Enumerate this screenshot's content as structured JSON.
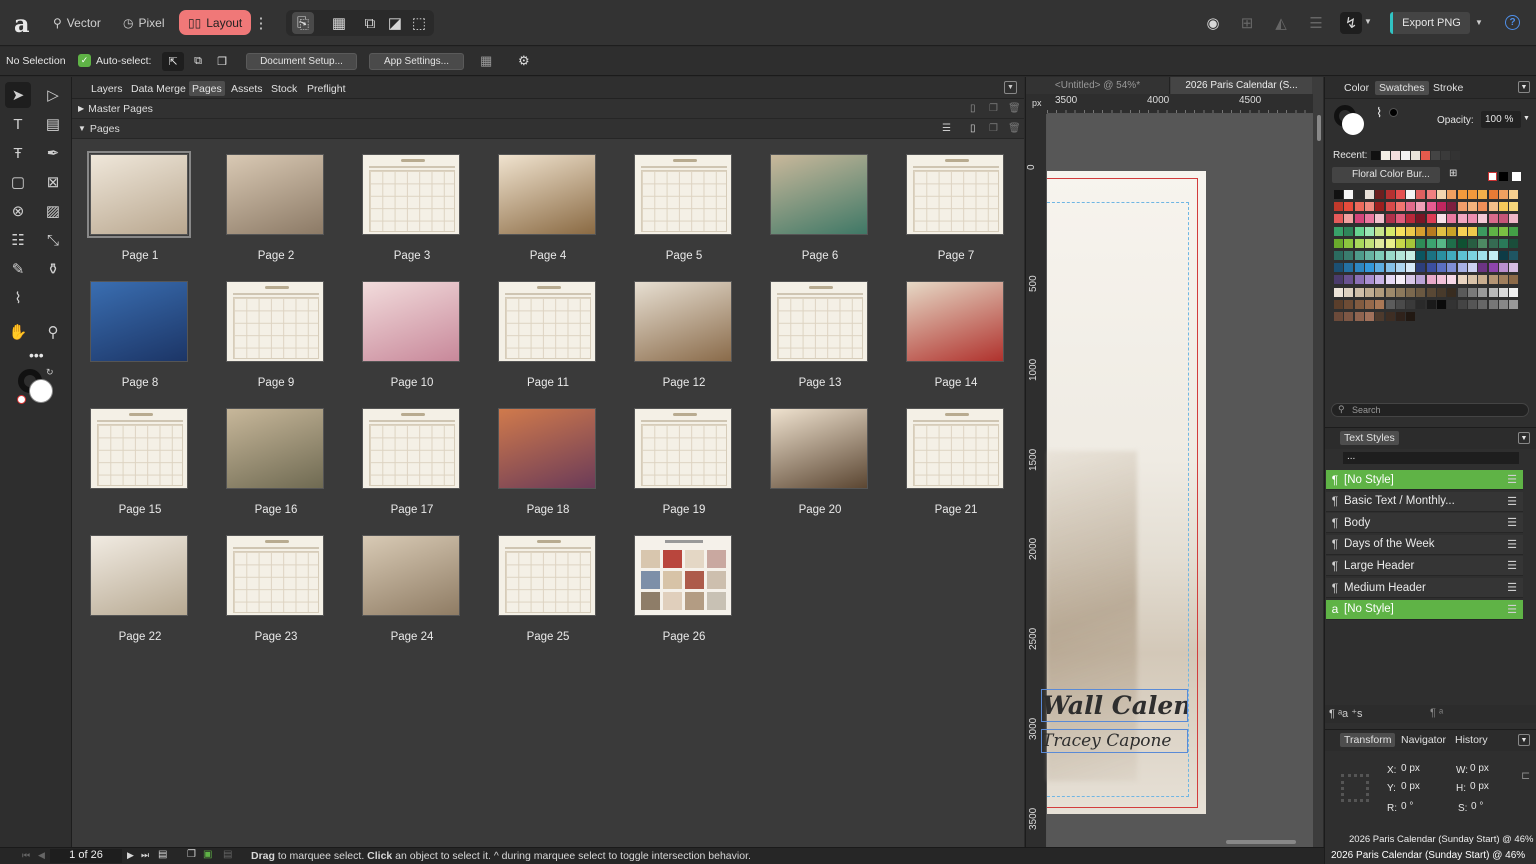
{
  "app": {
    "logo": "a"
  },
  "personas": [
    {
      "label": "Vector",
      "icon": "vector-persona-icon"
    },
    {
      "label": "Pixel",
      "icon": "pixel-persona-icon"
    },
    {
      "label": "Layout",
      "icon": "layout-persona-icon"
    }
  ],
  "topbar": {
    "export_label": "Export PNG",
    "help": "?"
  },
  "context": {
    "selection": "No Selection",
    "autoselect_label": "Auto-select:",
    "doc_setup": "Document Setup...",
    "app_settings": "App Settings..."
  },
  "panel_tabs": [
    "Layers",
    "Data Merge",
    "Pages",
    "Assets",
    "Stock",
    "Preflight"
  ],
  "sections": {
    "master": "Master Pages",
    "pages": "Pages"
  },
  "pages": [
    {
      "label": "Page 1",
      "kind": "photo",
      "c1": "#efe7da",
      "c2": "#b9a78f"
    },
    {
      "label": "Page 2",
      "kind": "photo",
      "c1": "#d9c9b4",
      "c2": "#8c7a66"
    },
    {
      "label": "Page 3",
      "kind": "cal"
    },
    {
      "label": "Page 4",
      "kind": "photo",
      "c1": "#f0e3cf",
      "c2": "#8a6a43"
    },
    {
      "label": "Page 5",
      "kind": "cal"
    },
    {
      "label": "Page 6",
      "kind": "photo",
      "c1": "#c9b89b",
      "c2": "#3f7866"
    },
    {
      "label": "Page 7",
      "kind": "cal"
    },
    {
      "label": "Page 8",
      "kind": "photo",
      "c1": "#3a6eb1",
      "c2": "#1c3566"
    },
    {
      "label": "Page 9",
      "kind": "cal"
    },
    {
      "label": "Page 10",
      "kind": "photo",
      "c1": "#f2dcdc",
      "c2": "#c8889a"
    },
    {
      "label": "Page 11",
      "kind": "cal"
    },
    {
      "label": "Page 12",
      "kind": "photo",
      "c1": "#e7dfd2",
      "c2": "#8a6b4a"
    },
    {
      "label": "Page 13",
      "kind": "cal"
    },
    {
      "label": "Page 14",
      "kind": "photo",
      "c1": "#e6d9c6",
      "c2": "#b0322d"
    },
    {
      "label": "Page 15",
      "kind": "cal"
    },
    {
      "label": "Page 16",
      "kind": "photo",
      "c1": "#c7b79a",
      "c2": "#6f6a52"
    },
    {
      "label": "Page 17",
      "kind": "cal"
    },
    {
      "label": "Page 18",
      "kind": "photo",
      "c1": "#d07a4c",
      "c2": "#6b3b58"
    },
    {
      "label": "Page 19",
      "kind": "cal"
    },
    {
      "label": "Page 20",
      "kind": "photo",
      "c1": "#efe2cf",
      "c2": "#5b4632"
    },
    {
      "label": "Page 21",
      "kind": "cal"
    },
    {
      "label": "Page 22",
      "kind": "photo",
      "c1": "#f1ebe2",
      "c2": "#b7a992"
    },
    {
      "label": "Page 23",
      "kind": "cal"
    },
    {
      "label": "Page 24",
      "kind": "photo",
      "c1": "#d8cab5",
      "c2": "#8f7c64"
    },
    {
      "label": "Page 25",
      "kind": "cal"
    },
    {
      "label": "Page 26",
      "kind": "collage"
    }
  ],
  "doc_tabs": [
    "<Untitled> @ 54%*",
    "2026 Paris Calendar (S..."
  ],
  "ruler": {
    "unit": "px",
    "h": [
      "3500",
      "4000",
      "4500"
    ],
    "v": [
      "0",
      "500",
      "1000",
      "1500",
      "2000",
      "2500",
      "3000",
      "3500"
    ]
  },
  "canvas_text": {
    "line1": "Wall Calendar",
    "line2": "Tracey Capone"
  },
  "color_panel": {
    "tabs": [
      "Color",
      "Swatches",
      "Stroke"
    ],
    "opacity_label": "Opacity:",
    "opacity_value": "100 %",
    "recent_label": "Recent:",
    "palette": "Floral Color Bur...",
    "search_placeholder": "Search"
  },
  "text_styles": {
    "tab": "Text Styles",
    "filter": "...",
    "items": [
      {
        "label": "[No Style]",
        "active": true,
        "icon": "¶"
      },
      {
        "label": "Basic Text / Monthly...",
        "active": false,
        "icon": "¶"
      },
      {
        "label": "Body",
        "active": false,
        "icon": "¶"
      },
      {
        "label": "Days of the Week",
        "active": false,
        "icon": "¶"
      },
      {
        "label": "Large Header",
        "active": false,
        "icon": "¶"
      },
      {
        "label": "Medium Header",
        "active": false,
        "icon": "¶"
      },
      {
        "label": "[No Style]",
        "active": true,
        "icon": "a"
      }
    ]
  },
  "transform": {
    "tabs": [
      "Transform",
      "Navigator",
      "History"
    ],
    "x_label": "X:",
    "x": "0 px",
    "y_label": "Y:",
    "y": "0 px",
    "w_label": "W:",
    "w": "0 px",
    "h_label": "H:",
    "h": "0 px",
    "r_label": "R:",
    "r": "0 °",
    "s_label": "S:",
    "s": "0 °"
  },
  "status": {
    "page_counter": "1 of 26",
    "hint_drag": "Drag",
    "hint1": " to marquee select. ",
    "hint_click": "Click",
    "hint2": " an object to select it. ^ during marquee select to toggle intersection behavior.",
    "doc_title1": "2026 Paris Calendar (Sunday Start) @ 46%",
    "doc_title2": "2026 Paris Calendar (Sunday Start) @ 46%"
  },
  "colors": {
    "accent": "#f07878",
    "green": "#5fb346"
  }
}
